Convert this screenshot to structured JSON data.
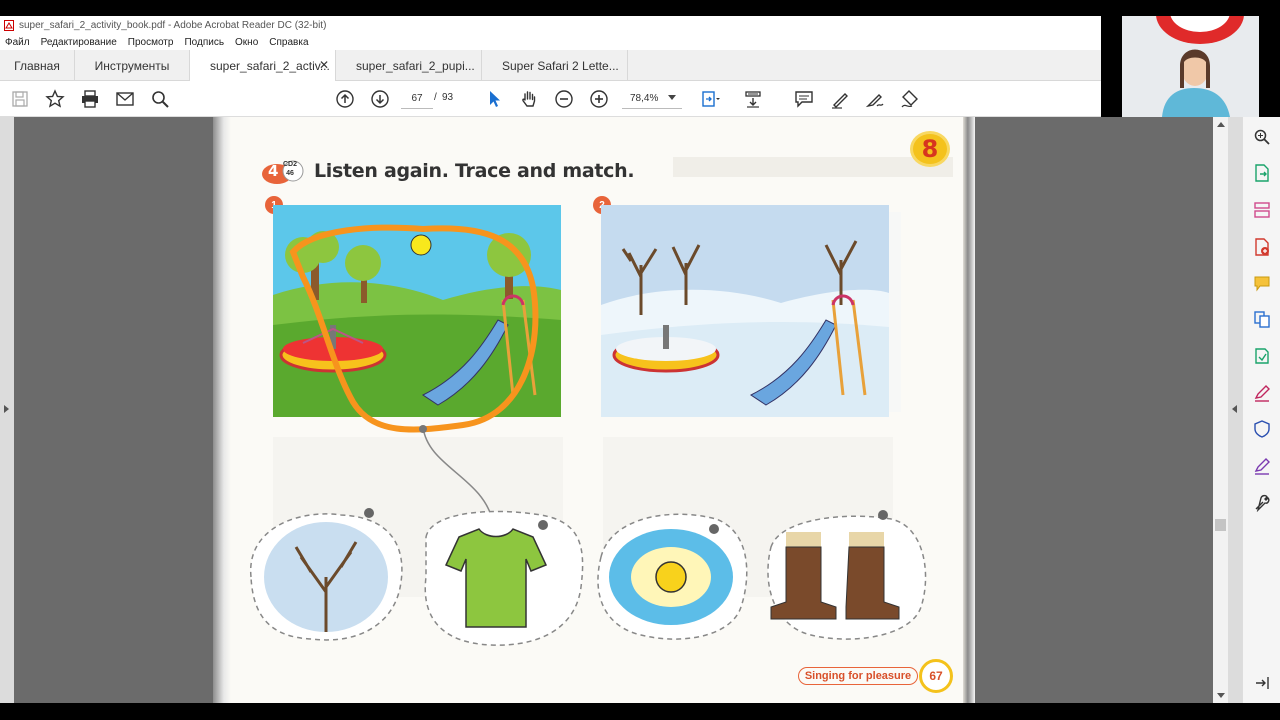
{
  "window": {
    "title": "super_safari_2_activity_book.pdf - Adobe Acrobat Reader DC (32-bit)"
  },
  "menu": [
    "Файл",
    "Редактирование",
    "Просмотр",
    "Подпись",
    "Окно",
    "Справка"
  ],
  "tabs": {
    "home": "Главная",
    "tools": "Инструменты",
    "documents": [
      {
        "label": "super_safari_2_activ...",
        "active": true
      },
      {
        "label": "super_safari_2_pupi...",
        "active": false
      },
      {
        "label": "Super Safari 2 Lette...",
        "active": false
      }
    ]
  },
  "toolbar": {
    "current_page": "67",
    "page_separator": "/",
    "total_pages": "93",
    "zoom": "78,4%"
  },
  "icons": {
    "toolbar_left": [
      "save-icon",
      "star-icon",
      "print-icon",
      "mail-icon",
      "search-icon"
    ],
    "toolbar_center": [
      "page-up-icon",
      "page-down-icon",
      "select-cursor-icon",
      "hand-icon",
      "zoom-out-icon",
      "zoom-in-icon",
      "fit-page-icon",
      "scroll-mode-icon"
    ],
    "toolbar_right": [
      "comment-icon",
      "highlight-pen-icon",
      "draw-icon",
      "sign-icon"
    ],
    "right_pane": [
      "zoom-search-icon",
      "export-pdf-icon",
      "organize-pages-icon",
      "create-pdf-icon",
      "comment-tool-icon",
      "combine-files-icon",
      "send-for-review-icon",
      "fill-sign-icon",
      "protect-icon",
      "edit-pdf-icon",
      "more-tools-icon",
      "collapse-pane-icon"
    ]
  },
  "page_content": {
    "unit_number": "8",
    "exercise_number": "4",
    "cd_label": "CD2",
    "track_label": "46",
    "heading": "Listen again. Trace and match.",
    "picture_1_number": "1",
    "picture_2_number": "2",
    "footer_label": "Singing for pleasure",
    "page_number": "67"
  },
  "colors": {
    "accent_orange": "#e8643a",
    "badge_yellow": "#f4c21c",
    "annotation_orange": "#f7941d",
    "doc_background": "#6b6b6b"
  }
}
